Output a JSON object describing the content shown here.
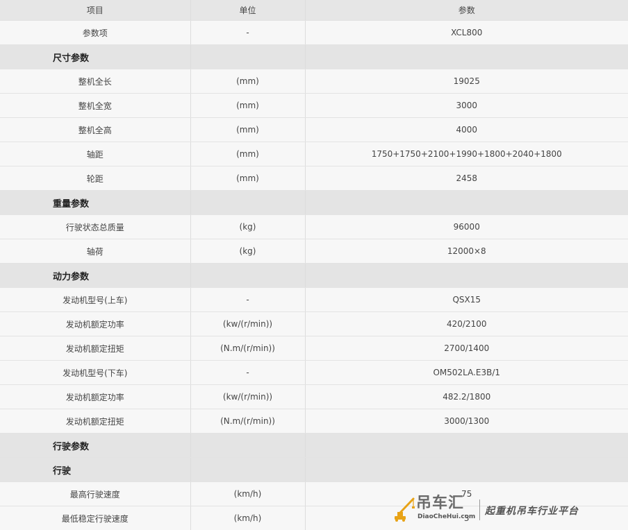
{
  "header": {
    "item": "项目",
    "unit": "单位",
    "param": "参数"
  },
  "rows": [
    {
      "type": "row",
      "label": "参数项",
      "unit": "-",
      "value": "XCL800"
    },
    {
      "type": "section",
      "label": "尺寸参数"
    },
    {
      "type": "row",
      "label": "整机全长",
      "unit": "(mm)",
      "value": "19025"
    },
    {
      "type": "row",
      "label": "整机全宽",
      "unit": "(mm)",
      "value": "3000"
    },
    {
      "type": "row",
      "label": "整机全高",
      "unit": "(mm)",
      "value": "4000"
    },
    {
      "type": "row",
      "label": "轴距",
      "unit": "(mm)",
      "value": "1750+1750+2100+1990+1800+2040+1800",
      "long": true
    },
    {
      "type": "row",
      "label": "轮距",
      "unit": "(mm)",
      "value": "2458"
    },
    {
      "type": "section",
      "label": "重量参数"
    },
    {
      "type": "row",
      "label": "行驶状态总质量",
      "unit": "(kg)",
      "value": "96000"
    },
    {
      "type": "row",
      "label": "轴荷",
      "unit": "(kg)",
      "value": "12000×8"
    },
    {
      "type": "section",
      "label": "动力参数"
    },
    {
      "type": "row",
      "label": "发动机型号(上车)",
      "unit": "-",
      "value": "QSX15"
    },
    {
      "type": "row",
      "label": "发动机额定功率",
      "unit": "(kw/(r/min))",
      "value": "420/2100"
    },
    {
      "type": "row",
      "label": "发动机额定扭矩",
      "unit": "(N.m/(r/min))",
      "value": "2700/1400"
    },
    {
      "type": "row",
      "label": "发动机型号(下车)",
      "unit": "-",
      "value": "OM502LA.E3B/1"
    },
    {
      "type": "row",
      "label": "发动机额定功率",
      "unit": "(kw/(r/min))",
      "value": "482.2/1800"
    },
    {
      "type": "row",
      "label": "发动机额定扭矩",
      "unit": "(N.m/(r/min))",
      "value": "3000/1300"
    },
    {
      "type": "section",
      "label": "行驶参数"
    },
    {
      "type": "section",
      "label": "行驶"
    },
    {
      "type": "row",
      "label": "最高行驶速度",
      "unit": "(km/h)",
      "value": "75"
    },
    {
      "type": "row",
      "label": "最低稳定行驶速度",
      "unit": "(km/h)",
      "value": "3"
    }
  ],
  "watermark": {
    "brand": "吊车汇",
    "domain": "DiaoCheHui.com",
    "slogan": "起重机吊车行业平台",
    "logo_icon": "crane-logo-icon",
    "logo_color": "#e8a317"
  },
  "colors": {
    "header_bg": "#e6e6e6",
    "section_bg": "#e4e4e4",
    "row_bg": "#f7f7f7",
    "border": "#dcdcdc"
  }
}
